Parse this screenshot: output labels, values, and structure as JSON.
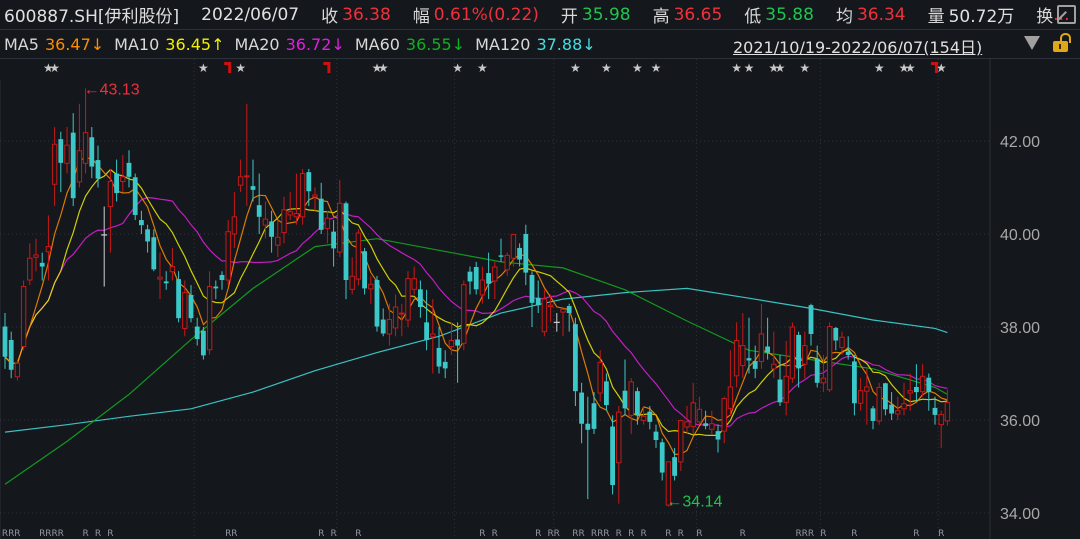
{
  "header": {
    "symbol": "600887.SH[伊利股份]",
    "date": "2022/06/07",
    "close_label": "收",
    "close": "36.38",
    "change_label": "幅",
    "change": "0.61%(0.22)",
    "open_label": "开",
    "open": "35.98",
    "high_label": "高",
    "high": "36.65",
    "low_label": "低",
    "low": "35.88",
    "avg_label": "均",
    "avg": "36.34",
    "volume_label": "量",
    "volume": "50.72万",
    "turnover_label": "换",
    "turnover_more": "..."
  },
  "ma_bar": {
    "items": [
      {
        "label": "MA5",
        "value": "36.47↓",
        "color": "#ff8c00"
      },
      {
        "label": "MA10",
        "value": "36.45↑",
        "color": "#f0f000"
      },
      {
        "label": "MA20",
        "value": "36.72↓",
        "color": "#e020e0"
      },
      {
        "label": "MA60",
        "value": "36.55↓",
        "color": "#10b020"
      },
      {
        "label": "MA120",
        "value": "37.88↓",
        "color": "#40e0e0"
      }
    ],
    "range": "2021/10/19-2022/06/07(154日)"
  },
  "icons": {
    "popout": "popout-window-icon",
    "dropdown": "triangle-down-icon",
    "lock": "unlocked-padlock-icon"
  },
  "colors": {
    "up": "#c81818",
    "down": "#3cc8c8",
    "background": "#14171c"
  },
  "chart_data": {
    "type": "candlestick",
    "ylim": [
      33.9,
      44.3
    ],
    "y_ticks": [
      "42.00",
      "40.00",
      "38.00",
      "36.00",
      "34.00"
    ],
    "y_tick_values": [
      42,
      40,
      38,
      36,
      34
    ],
    "grid": true,
    "candles_ohlc": [
      [
        38.01,
        38.3,
        37.1,
        37.36
      ],
      [
        37.72,
        37.9,
        36.9,
        37.08
      ],
      [
        36.93,
        37.3,
        36.85,
        37.22
      ],
      [
        37.58,
        39.0,
        37.5,
        38.87
      ],
      [
        39.01,
        39.8,
        38.9,
        39.48
      ],
      [
        39.5,
        39.9,
        39.2,
        39.55
      ],
      [
        39.38,
        39.6,
        39.0,
        39.3
      ],
      [
        39.62,
        40.4,
        39.0,
        39.73
      ],
      [
        41.07,
        42.3,
        40.6,
        41.93
      ],
      [
        42.04,
        42.2,
        40.9,
        41.53
      ],
      [
        41.52,
        42.3,
        41.3,
        41.91
      ],
      [
        42.18,
        42.6,
        40.6,
        40.77
      ],
      [
        41.12,
        42.8,
        41.0,
        41.79
      ],
      [
        41.52,
        43.13,
        41.3,
        42.18
      ],
      [
        42.08,
        42.3,
        41.2,
        41.45
      ],
      [
        41.59,
        41.9,
        41.0,
        41.19
      ],
      [
        39.98,
        40.59,
        38.87,
        39.98
      ],
      [
        40.59,
        41.4,
        39.6,
        41.13
      ],
      [
        41.3,
        41.6,
        40.7,
        40.88
      ],
      [
        41.13,
        41.7,
        40.9,
        41.23
      ],
      [
        41.53,
        41.8,
        41.0,
        41.23
      ],
      [
        41.22,
        41.3,
        40.3,
        40.41
      ],
      [
        40.3,
        40.5,
        40.0,
        40.19
      ],
      [
        40.1,
        40.2,
        39.6,
        39.84
      ],
      [
        39.93,
        40.1,
        39.2,
        39.24
      ],
      [
        39.03,
        39.6,
        38.6,
        39.07
      ],
      [
        38.98,
        39.2,
        38.8,
        38.94
      ],
      [
        39.19,
        39.7,
        39.0,
        39.3
      ],
      [
        39.03,
        39.2,
        38.1,
        38.19
      ],
      [
        37.97,
        39.0,
        37.8,
        38.74
      ],
      [
        38.69,
        38.9,
        38.1,
        38.19
      ],
      [
        38.01,
        38.2,
        37.6,
        37.74
      ],
      [
        37.92,
        38.0,
        37.3,
        37.39
      ],
      [
        37.51,
        39.2,
        37.4,
        38.87
      ],
      [
        38.87,
        39.0,
        38.6,
        38.83
      ],
      [
        39.12,
        39.2,
        38.8,
        39.01
      ],
      [
        39.01,
        40.3,
        38.9,
        40.05
      ],
      [
        40.0,
        40.9,
        39.7,
        40.37
      ],
      [
        41.05,
        41.6,
        40.9,
        41.23
      ],
      [
        41.23,
        42.8,
        40.6,
        41.25
      ],
      [
        41.03,
        41.6,
        40.7,
        40.95
      ],
      [
        40.62,
        41.3,
        40.0,
        40.37
      ],
      [
        40.19,
        40.7,
        39.9,
        40.32
      ],
      [
        40.27,
        40.5,
        39.6,
        39.94
      ],
      [
        39.76,
        40.3,
        39.5,
        39.93
      ],
      [
        40.03,
        40.8,
        39.8,
        40.52
      ],
      [
        40.41,
        40.9,
        40.3,
        40.48
      ],
      [
        40.37,
        41.3,
        40.2,
        40.44
      ],
      [
        40.37,
        41.4,
        40.2,
        41.3
      ],
      [
        41.33,
        41.4,
        40.6,
        40.92
      ],
      [
        40.8,
        41.0,
        40.5,
        40.84
      ],
      [
        40.76,
        41.1,
        40.0,
        40.09
      ],
      [
        40.12,
        40.5,
        39.8,
        40.34
      ],
      [
        40.05,
        40.3,
        39.3,
        39.69
      ],
      [
        39.61,
        41.16,
        39.5,
        40.66
      ],
      [
        40.66,
        40.7,
        38.6,
        39.01
      ],
      [
        38.81,
        39.5,
        38.7,
        39.09
      ],
      [
        39.03,
        40.1,
        38.9,
        40.02
      ],
      [
        39.63,
        39.7,
        38.7,
        38.83
      ],
      [
        38.82,
        39.1,
        38.5,
        38.92
      ],
      [
        39.01,
        39.1,
        37.9,
        38.01
      ],
      [
        38.16,
        38.4,
        37.8,
        37.86
      ],
      [
        37.85,
        38.5,
        37.6,
        38.16
      ],
      [
        37.98,
        38.7,
        37.8,
        38.43
      ],
      [
        38.28,
        38.5,
        37.8,
        38.3
      ],
      [
        38.15,
        39.2,
        38.0,
        39.04
      ],
      [
        38.81,
        39.3,
        38.7,
        39.04
      ],
      [
        38.81,
        39.0,
        38.2,
        38.43
      ],
      [
        38.1,
        38.8,
        37.5,
        37.72
      ],
      [
        37.79,
        38.6,
        37.0,
        37.85
      ],
      [
        37.55,
        38.0,
        37.0,
        37.15
      ],
      [
        37.25,
        37.5,
        36.9,
        37.11
      ],
      [
        37.58,
        38.1,
        37.4,
        37.71
      ],
      [
        37.73,
        38.1,
        36.8,
        37.6
      ],
      [
        37.65,
        39.0,
        37.5,
        38.91
      ],
      [
        39.19,
        39.3,
        38.7,
        38.98
      ],
      [
        39.29,
        39.4,
        38.7,
        38.81
      ],
      [
        38.69,
        39.3,
        38.5,
        39.01
      ],
      [
        39.16,
        39.6,
        38.6,
        38.93
      ],
      [
        38.99,
        39.4,
        38.6,
        39.29
      ],
      [
        39.54,
        39.9,
        39.4,
        39.51
      ],
      [
        39.23,
        39.6,
        39.1,
        39.54
      ],
      [
        39.48,
        40.0,
        39.3,
        39.99
      ],
      [
        39.7,
        39.8,
        39.3,
        39.45
      ],
      [
        40.0,
        40.2,
        38.9,
        39.17
      ],
      [
        39.12,
        39.2,
        38.0,
        38.52
      ],
      [
        38.63,
        39.0,
        38.3,
        38.47
      ],
      [
        37.9,
        38.8,
        37.8,
        38.6
      ],
      [
        38.44,
        38.7,
        38.1,
        38.47
      ],
      [
        38.1,
        38.3,
        37.9,
        38.1
      ],
      [
        38.32,
        38.4,
        37.8,
        38.38
      ],
      [
        38.45,
        38.5,
        37.9,
        38.3
      ],
      [
        38.06,
        38.2,
        36.3,
        36.62
      ],
      [
        36.59,
        36.8,
        35.5,
        35.92
      ],
      [
        35.92,
        36.5,
        34.3,
        35.79
      ],
      [
        36.36,
        36.6,
        35.7,
        35.81
      ],
      [
        36.58,
        37.5,
        36.4,
        37.24
      ],
      [
        36.83,
        37.0,
        36.2,
        36.32
      ],
      [
        35.86,
        36.1,
        34.4,
        34.6
      ],
      [
        35.08,
        36.3,
        34.2,
        36.17
      ],
      [
        36.63,
        37.3,
        36.1,
        36.25
      ],
      [
        36.1,
        36.9,
        35.7,
        36.82
      ],
      [
        36.62,
        36.7,
        35.9,
        36.1
      ],
      [
        35.99,
        36.3,
        35.9,
        36.08
      ],
      [
        36.18,
        36.3,
        35.8,
        35.96
      ],
      [
        35.75,
        35.9,
        35.4,
        35.57
      ],
      [
        35.52,
        35.6,
        34.7,
        34.87
      ],
      [
        34.17,
        35.1,
        34.14,
        35.1
      ],
      [
        35.2,
        35.4,
        34.7,
        34.8
      ],
      [
        35.1,
        36.0,
        34.9,
        35.99
      ],
      [
        35.85,
        36.3,
        35.7,
        35.96
      ],
      [
        35.86,
        36.8,
        35.7,
        36.37
      ],
      [
        35.96,
        36.5,
        35.9,
        36.23
      ],
      [
        35.93,
        36.2,
        35.8,
        35.87
      ],
      [
        35.8,
        36.2,
        35.7,
        35.92
      ],
      [
        35.76,
        35.9,
        35.3,
        35.58
      ],
      [
        35.76,
        36.5,
        35.5,
        36.46
      ],
      [
        36.25,
        37.5,
        36.1,
        36.71
      ],
      [
        36.95,
        38.1,
        36.7,
        37.71
      ],
      [
        37.17,
        38.3,
        36.9,
        37.6
      ],
      [
        37.33,
        38.2,
        37.0,
        37.28
      ],
      [
        37.27,
        37.6,
        36.9,
        37.1
      ],
      [
        37.26,
        38.5,
        37.1,
        37.85
      ],
      [
        37.58,
        38.2,
        37.3,
        37.45
      ],
      [
        37.1,
        37.9,
        36.9,
        37.2
      ],
      [
        36.87,
        37.4,
        36.3,
        36.38
      ],
      [
        36.38,
        37.7,
        36.1,
        36.94
      ],
      [
        36.9,
        38.1,
        36.8,
        38.0
      ],
      [
        37.83,
        37.9,
        36.7,
        37.11
      ],
      [
        37.2,
        37.9,
        36.9,
        37.6
      ],
      [
        38.47,
        38.5,
        37.6,
        37.85
      ],
      [
        37.32,
        37.6,
        36.7,
        36.8
      ],
      [
        36.8,
        37.4,
        36.6,
        36.9
      ],
      [
        36.65,
        38.1,
        36.6,
        38.01
      ],
      [
        37.98,
        38.0,
        37.5,
        37.71
      ],
      [
        37.56,
        37.9,
        37.4,
        37.78
      ],
      [
        37.47,
        37.8,
        37.3,
        37.4
      ],
      [
        37.26,
        37.4,
        36.1,
        36.36
      ],
      [
        36.36,
        36.9,
        36.2,
        36.63
      ],
      [
        36.62,
        37.1,
        35.9,
        36.71
      ],
      [
        36.25,
        36.3,
        35.8,
        35.98
      ],
      [
        35.98,
        36.8,
        35.9,
        36.7
      ],
      [
        36.79,
        36.8,
        36.1,
        36.23
      ],
      [
        36.33,
        36.6,
        36.0,
        36.14
      ],
      [
        36.13,
        36.5,
        36.0,
        36.2
      ],
      [
        36.24,
        36.8,
        36.1,
        36.35
      ],
      [
        36.58,
        37.0,
        36.2,
        36.63
      ],
      [
        36.71,
        37.2,
        36.4,
        36.6
      ],
      [
        36.61,
        37.2,
        36.5,
        36.94
      ],
      [
        36.91,
        37.0,
        36.2,
        36.6
      ],
      [
        36.26,
        36.5,
        35.9,
        36.11
      ],
      [
        35.9,
        36.2,
        35.4,
        36.12
      ],
      [
        35.98,
        36.65,
        35.88,
        36.38
      ]
    ],
    "ma60_every10": [
      34.62,
      35.54,
      36.55,
      37.73,
      38.83,
      39.73,
      39.9,
      39.65,
      39.4,
      39.27,
      38.8,
      38.13,
      37.5,
      37.3,
      37.1,
      36.7,
      36.55
    ],
    "ma120_every10": [
      35.74,
      35.9,
      36.08,
      36.24,
      36.6,
      37.06,
      37.45,
      37.8,
      38.3,
      38.6,
      38.74,
      38.83,
      38.62,
      38.4,
      38.15,
      37.97,
      37.88
    ],
    "annotations": [
      {
        "candle": 13,
        "text": "←43.13",
        "color": "#f0303a"
      },
      {
        "candle": 107,
        "text": "←34.14",
        "color": "#1fc44f"
      }
    ],
    "star_marks": [
      7,
      8,
      32,
      38,
      60,
      61,
      73,
      77,
      92,
      97,
      102,
      105,
      118,
      120,
      124,
      125,
      129,
      141,
      145,
      146,
      151
    ],
    "flag_marks": [
      36,
      52,
      150
    ],
    "bottom_marks": {
      "text": "R",
      "candles": [
        0,
        1,
        2,
        6,
        7,
        8,
        9,
        13,
        15,
        17,
        36,
        37,
        51,
        53,
        57,
        77,
        79,
        86,
        88,
        89,
        92,
        93,
        95,
        96,
        97,
        99,
        101,
        103,
        107,
        109,
        112,
        119,
        128,
        129,
        130,
        132,
        137,
        147,
        151
      ]
    }
  }
}
